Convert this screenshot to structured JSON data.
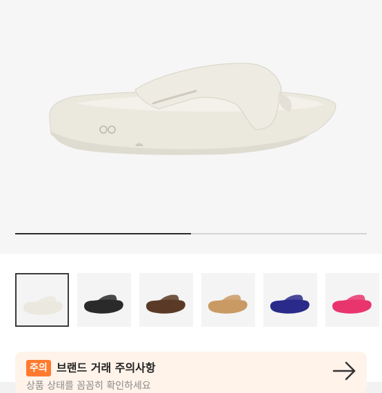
{
  "product": {
    "logo_mark": "OO",
    "selected_index": 0,
    "slider_progress": 0.5,
    "thumbnails": [
      {
        "color": "white",
        "fill": "#ebe8df"
      },
      {
        "color": "black",
        "fill": "#2a2a2a"
      },
      {
        "color": "brown",
        "fill": "#5a3a26"
      },
      {
        "color": "tan",
        "fill": "#c99a63"
      },
      {
        "color": "navy",
        "fill": "#2a2a8a"
      },
      {
        "color": "pink",
        "fill": "#e8356e"
      }
    ]
  },
  "notice": {
    "badge": "주의",
    "title": "브랜드 거래 주의사항",
    "subtitle": "상품 상태를 꼼꼼히 확인하세요",
    "arrow_icon": "arrow-right-icon"
  },
  "colors": {
    "accent": "#ff7a2e",
    "notice_bg": "#fff3ea"
  }
}
